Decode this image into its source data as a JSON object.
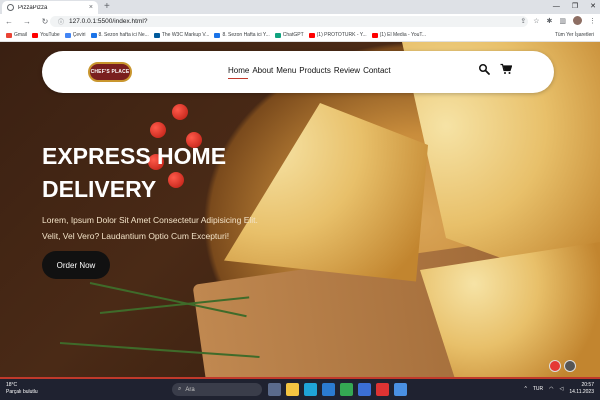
{
  "browser": {
    "tab_title": "PizzaPizza",
    "tab_close": "×",
    "new_tab": "+",
    "url": "127.0.0.1:5500/index.html?",
    "window_controls": [
      "—",
      "❐",
      "✕"
    ],
    "bookmarks": [
      {
        "label": "Gmail",
        "color": "#ea4335"
      },
      {
        "label": "YouTube",
        "color": "#ff0000"
      },
      {
        "label": "Çeviri",
        "color": "#4285f4"
      },
      {
        "label": "8. Sezon hafta ici Ne...",
        "color": "#1a73e8"
      },
      {
        "label": "The W3C Markup V...",
        "color": "#005a9c"
      },
      {
        "label": "8. Sezon Hafta ici Y...",
        "color": "#1a73e8"
      },
      {
        "label": "ChatGPT",
        "color": "#10a37f"
      },
      {
        "label": "(1) PROTOTURK - Y...",
        "color": "#ff0000"
      },
      {
        "label": "(1) El Media - YouT...",
        "color": "#ff0000"
      }
    ],
    "all_bookmarks": "Tüm Yer İşaretleri"
  },
  "site": {
    "logo_text": "CHEF'S PLACE",
    "nav": [
      "Home",
      "About",
      "Menu",
      "Products",
      "Review",
      "Contact"
    ],
    "hero_title": "EXPRESS HOME DELIVERY",
    "hero_text": "Lorem, Ipsum Dolor Sit Amet Consectetur Adipisicing Elit. Velit, Vel Vero? Laudantium Optio Cum Excepturi!",
    "order_button": "Order Now",
    "accent": "#c0392b"
  },
  "taskbar": {
    "weather_temp": "18°C",
    "weather_desc": "Parçalı bulutlu",
    "search_placeholder": "Ara",
    "language": "TUR",
    "time": "20:57",
    "date": "14.11.2023"
  }
}
